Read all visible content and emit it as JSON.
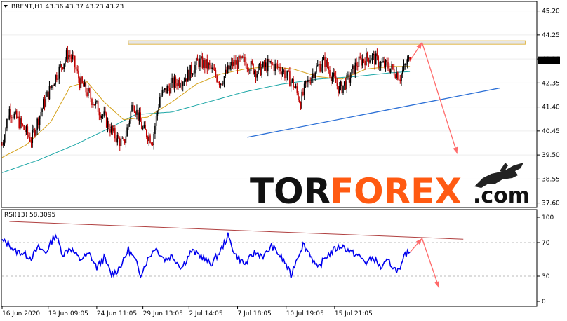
{
  "chart_data": [
    {
      "type": "candlestick",
      "title": "BRENT,H1  43.36 43.37 43.23 43.23",
      "y_ticks": [
        "45.20",
        "44.25",
        "43.30",
        "42.35",
        "41.40",
        "40.45",
        "39.50",
        "38.55",
        "37.60"
      ],
      "y_tick_values": [
        45.2,
        44.25,
        43.3,
        42.35,
        41.4,
        40.45,
        39.5,
        38.55,
        37.6
      ],
      "ylim": [
        37.45,
        45.55
      ],
      "current_price": "43.23",
      "x_ticks": [
        "16 Jun 2020",
        "19 Jun 09:05",
        "24 Jun 11:05",
        "29 Jun 13:05",
        "2 Jul 14:05",
        "7 Jul 18:05",
        "10 Jul 19:05",
        "15 Jul 21:05"
      ],
      "close_anchors": [
        [
          0,
          39.9
        ],
        [
          6,
          41.3
        ],
        [
          14,
          40.8
        ],
        [
          24,
          40.1
        ],
        [
          34,
          41.5
        ],
        [
          44,
          42.6
        ],
        [
          54,
          43.5
        ],
        [
          58,
          43.3
        ],
        [
          64,
          42.4
        ],
        [
          74,
          41.7
        ],
        [
          84,
          41.0
        ],
        [
          92,
          40.3
        ],
        [
          100,
          39.9
        ],
        [
          108,
          41.6
        ],
        [
          116,
          40.5
        ],
        [
          124,
          40.1
        ],
        [
          130,
          41.8
        ],
        [
          140,
          42.3
        ],
        [
          152,
          42.6
        ],
        [
          162,
          43.2
        ],
        [
          170,
          43.0
        ],
        [
          180,
          42.4
        ],
        [
          190,
          43.1
        ],
        [
          200,
          43.2
        ],
        [
          210,
          42.8
        ],
        [
          220,
          43.1
        ],
        [
          230,
          42.9
        ],
        [
          240,
          42.3
        ],
        [
          246,
          41.6
        ],
        [
          250,
          42.2
        ],
        [
          258,
          42.9
        ],
        [
          266,
          43.2
        ],
        [
          272,
          42.6
        ],
        [
          278,
          42.1
        ],
        [
          286,
          42.5
        ],
        [
          292,
          43.1
        ],
        [
          298,
          43.3
        ],
        [
          304,
          43.4
        ],
        [
          312,
          43.1
        ],
        [
          318,
          43.0
        ],
        [
          324,
          42.8
        ],
        [
          328,
          42.6
        ],
        [
          334,
          43.2
        ],
        [
          336,
          43.23
        ]
      ],
      "ma_fast_anchors": [
        [
          0,
          39.4
        ],
        [
          20,
          39.9
        ],
        [
          40,
          40.8
        ],
        [
          56,
          42.2
        ],
        [
          70,
          42.4
        ],
        [
          84,
          41.6
        ],
        [
          100,
          40.9
        ],
        [
          120,
          41.0
        ],
        [
          140,
          41.6
        ],
        [
          160,
          42.3
        ],
        [
          180,
          42.7
        ],
        [
          200,
          42.9
        ],
        [
          220,
          43.0
        ],
        [
          240,
          42.9
        ],
        [
          260,
          42.6
        ],
        [
          280,
          42.5
        ],
        [
          300,
          42.9
        ],
        [
          320,
          43.0
        ],
        [
          336,
          43.0
        ]
      ],
      "ma_slow_anchors": [
        [
          0,
          38.8
        ],
        [
          30,
          39.3
        ],
        [
          60,
          39.9
        ],
        [
          90,
          40.6
        ],
        [
          110,
          41.1
        ],
        [
          140,
          41.2
        ],
        [
          170,
          41.6
        ],
        [
          200,
          42.0
        ],
        [
          230,
          42.3
        ],
        [
          260,
          42.5
        ],
        [
          290,
          42.6
        ],
        [
          320,
          42.75
        ],
        [
          336,
          42.8
        ]
      ],
      "resistance_zone": {
        "x_start": 104,
        "x_end": 431,
        "y_high": 44.02,
        "y_low": 43.88
      },
      "support_line": {
        "x_start": 202,
        "y_start": 40.2,
        "x_end": 410,
        "y_end": 42.15
      },
      "forecast_path": [
        [
          336,
          43.23
        ],
        [
          346,
          43.95
        ],
        [
          375,
          39.55
        ]
      ]
    },
    {
      "type": "line",
      "title": "RSI(13) 58.3095",
      "y_ticks": [
        "100",
        "70",
        "30",
        "0"
      ],
      "y_tick_values": [
        100,
        70,
        30,
        0
      ],
      "ylim": [
        0,
        100
      ],
      "rsi_anchors": [
        [
          0,
          72
        ],
        [
          6,
          68
        ],
        [
          10,
          60
        ],
        [
          16,
          58
        ],
        [
          24,
          52
        ],
        [
          30,
          64
        ],
        [
          36,
          58
        ],
        [
          44,
          80
        ],
        [
          50,
          56
        ],
        [
          56,
          64
        ],
        [
          64,
          50
        ],
        [
          72,
          56
        ],
        [
          78,
          40
        ],
        [
          84,
          52
        ],
        [
          90,
          32
        ],
        [
          94,
          35
        ],
        [
          100,
          48
        ],
        [
          104,
          62
        ],
        [
          110,
          48
        ],
        [
          114,
          32
        ],
        [
          120,
          50
        ],
        [
          126,
          64
        ],
        [
          134,
          50
        ],
        [
          140,
          54
        ],
        [
          148,
          40
        ],
        [
          156,
          60
        ],
        [
          164,
          54
        ],
        [
          172,
          44
        ],
        [
          180,
          60
        ],
        [
          186,
          78
        ],
        [
          192,
          56
        ],
        [
          200,
          44
        ],
        [
          208,
          58
        ],
        [
          216,
          54
        ],
        [
          222,
          66
        ],
        [
          228,
          56
        ],
        [
          234,
          44
        ],
        [
          238,
          30
        ],
        [
          242,
          48
        ],
        [
          248,
          68
        ],
        [
          254,
          56
        ],
        [
          260,
          38
        ],
        [
          266,
          52
        ],
        [
          274,
          62
        ],
        [
          280,
          66
        ],
        [
          288,
          58
        ],
        [
          294,
          54
        ],
        [
          300,
          46
        ],
        [
          306,
          52
        ],
        [
          312,
          40
        ],
        [
          318,
          48
        ],
        [
          324,
          38
        ],
        [
          328,
          36
        ],
        [
          332,
          56
        ],
        [
          336,
          58.31
        ]
      ],
      "trend_line": {
        "x_start": 6,
        "y_start": 95,
        "x_end": 380,
        "y_end": 74
      },
      "forecast_path": [
        [
          336,
          58.31
        ],
        [
          346,
          75
        ],
        [
          360,
          16
        ]
      ]
    }
  ],
  "watermark": {
    "tor": "TOR",
    "forex": "FOREX",
    "com": ".com"
  },
  "colors": {
    "bull": "#000000",
    "bear": "#c00000",
    "ma_fast": "#d4a017",
    "ma_slow": "#1aa6a6",
    "rsi": "#0000ee",
    "support": "#2b6fd6",
    "forecast": "#ff6a6a",
    "trend": "#b04040",
    "zone_fill": "#e6e6e6",
    "zone_stroke": "#e0b84a",
    "logo_orange": "#ff5a12"
  }
}
